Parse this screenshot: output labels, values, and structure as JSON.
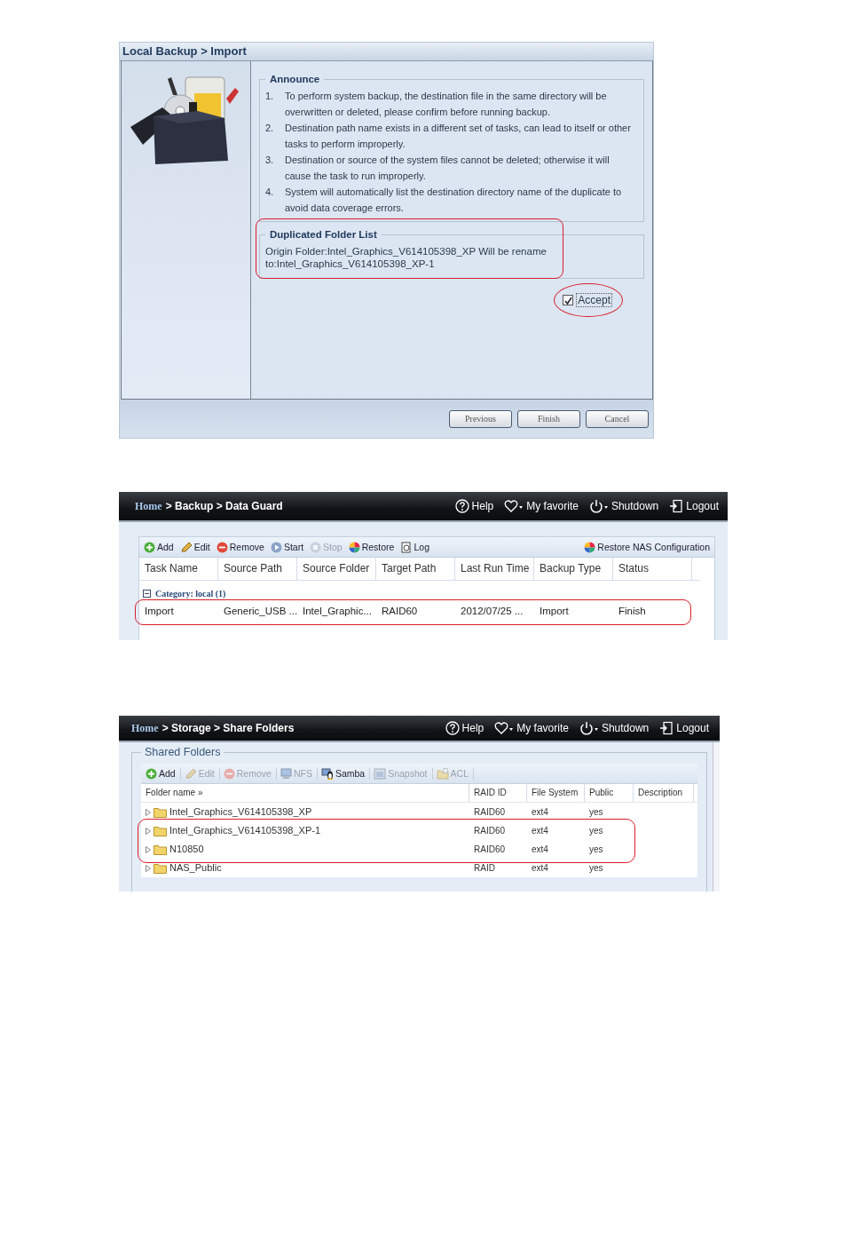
{
  "import_dialog": {
    "breadcrumb": "Local Backup > Import",
    "announce": {
      "legend": "Announce",
      "items": [
        {
          "number": "1.",
          "text": "To perform system backup, the destination file in the same directory will be overwritten or deleted, please confirm before running backup."
        },
        {
          "number": "2.",
          "text": "Destination path name exists in a different set of tasks, can lead to itself or other tasks to perform improperly."
        },
        {
          "number": "3.",
          "text": "Destination or source of the system files cannot be deleted; otherwise it will cause the task to run improperly."
        },
        {
          "number": "4.",
          "text": "System will automatically list the destination directory name of the duplicate to avoid data coverage errors."
        }
      ]
    },
    "duplicated": {
      "legend": "Duplicated Folder List",
      "text": "Origin Folder:Intel_Graphics_V614105398_XP Will be rename to:Intel_Graphics_V614105398_XP-1",
      "highlighted": true
    },
    "accept": {
      "label": "Accept",
      "checked": true,
      "highlighted": true
    },
    "buttons": [
      "Previous",
      "Finish",
      "Cancel"
    ]
  },
  "data_guard": {
    "breadcrumb": {
      "home": "Home",
      "path": "> Backup > Data Guard"
    },
    "top_actions": [
      {
        "kind": "help",
        "label": "Help"
      },
      {
        "kind": "favorite",
        "label": "My favorite"
      },
      {
        "kind": "power",
        "label": "Shutdown"
      },
      {
        "kind": "logout",
        "label": "Logout"
      }
    ],
    "toolbar": [
      {
        "kind": "add",
        "label": "Add",
        "disabled": false
      },
      {
        "kind": "edit",
        "label": "Edit",
        "disabled": false
      },
      {
        "kind": "remove",
        "label": "Remove",
        "disabled": false
      },
      {
        "kind": "start",
        "label": "Start",
        "disabled": false
      },
      {
        "kind": "stop",
        "label": "Stop",
        "disabled": true
      },
      {
        "kind": "restore",
        "label": "Restore",
        "disabled": false
      },
      {
        "kind": "log",
        "label": "Log",
        "disabled": false
      }
    ],
    "right_action": {
      "kind": "restore",
      "label": "Restore NAS Configuration"
    },
    "columns": [
      "Task Name",
      "Source Path",
      "Source Folder",
      "Target Path",
      "Last Run Time",
      "Backup Type",
      "Status"
    ],
    "category": "Category: local (1)",
    "rows": [
      {
        "cells": [
          "Import",
          "Generic_USB ...",
          "Intel_Graphic...",
          "RAID60",
          "2012/07/25 ...",
          "Import",
          "Finish"
        ],
        "highlighted": true
      }
    ]
  },
  "share_folders": {
    "breadcrumb": {
      "home": "Home",
      "path": "> Storage > Share Folders"
    },
    "top_actions": [
      {
        "kind": "help",
        "label": "Help"
      },
      {
        "kind": "favorite",
        "label": "My favorite"
      },
      {
        "kind": "power",
        "label": "Shutdown"
      },
      {
        "kind": "logout",
        "label": "Logout"
      }
    ],
    "legend": "Shared Folders",
    "toolbar": [
      {
        "kind": "add",
        "label": "Add",
        "disabled": false
      },
      {
        "kind": "edit",
        "label": "Edit",
        "disabled": true
      },
      {
        "kind": "remove",
        "label": "Remove",
        "disabled": true
      },
      {
        "kind": "nfs",
        "label": "NFS",
        "disabled": true
      },
      {
        "kind": "samba",
        "label": "Samba",
        "disabled": false
      },
      {
        "kind": "snapshot",
        "label": "Snapshot",
        "disabled": true
      },
      {
        "kind": "acl",
        "label": "ACL",
        "disabled": true
      }
    ],
    "columns": [
      "Folder name »",
      "RAID ID",
      "File System",
      "Public",
      "Description"
    ],
    "rows": [
      {
        "name": "Intel_Graphics_V614105398_XP",
        "raid_id": "RAID60",
        "file_system": "ext4",
        "public": "yes",
        "highlighted": false
      },
      {
        "name": "Intel_Graphics_V614105398_XP-1",
        "raid_id": "RAID60",
        "file_system": "ext4",
        "public": "yes",
        "highlighted": true
      },
      {
        "name": "N10850",
        "raid_id": "RAID60",
        "file_system": "ext4",
        "public": "yes",
        "highlighted": true
      },
      {
        "name": "NAS_Public",
        "raid_id": "RAID",
        "file_system": "ext4",
        "public": "yes",
        "highlighted": false
      }
    ]
  }
}
